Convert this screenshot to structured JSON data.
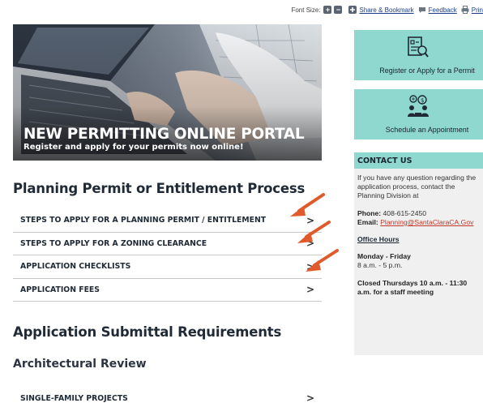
{
  "toolbar": {
    "font_size_label": "Font Size:",
    "increase_glyph": "+",
    "decrease_glyph": "−",
    "share_label": "Share & Bookmark",
    "feedback_label": "Feedback",
    "print_label": "Prin"
  },
  "banner": {
    "title": "NEW PERMITTING ONLINE PORTAL",
    "subtitle": "Register and apply for your permits now online!"
  },
  "section1": {
    "heading": "Planning Permit or Entitlement Process",
    "items": [
      {
        "label": "STEPS TO APPLY FOR A PLANNING PERMIT / ENTITLEMENT"
      },
      {
        "label": "STEPS TO APPLY FOR A ZONING CLEARANCE"
      },
      {
        "label": "APPLICATION CHECKLISTS"
      },
      {
        "label": "APPLICATION FEES"
      }
    ]
  },
  "section2": {
    "heading": "Application Submittal Requirements",
    "subheading": "Architectural Review",
    "items": [
      {
        "label": "SINGLE-FAMILY PROJECTS"
      }
    ]
  },
  "chevron": ">",
  "sidebar": {
    "register_label": "Register or Apply for a Permit",
    "appointment_label": "Schedule an Appointment",
    "tile_color": "#8fd8cf",
    "contact": {
      "heading": "CONTACT US",
      "intro": "If you have any question regarding the application process, contact the Planning Division at",
      "phone_label": "Phone:",
      "phone": "408-615-2450",
      "email_label": "Email:",
      "email": "Planning@SantaClaraCA.Gov",
      "office_hours_label": "Office Hours",
      "days": "Monday - Friday",
      "hours": "8 a.m. - 5 p.m.",
      "closed_note": "Closed Thursdays 10 a.m. - 11:30 a.m. for a staff meeting"
    }
  },
  "arrow_color": "#e05a2b"
}
